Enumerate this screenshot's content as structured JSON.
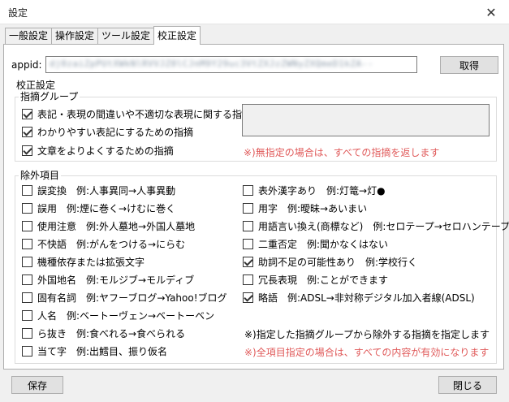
{
  "window": {
    "title": "設定",
    "close_glyph": "✕"
  },
  "tabs": [
    {
      "label": "一般設定",
      "active": false
    },
    {
      "label": "操作設定",
      "active": false
    },
    {
      "label": "ツール設定",
      "active": false
    },
    {
      "label": "校正設定",
      "active": true
    }
  ],
  "appid": {
    "label": "appid:",
    "value": "dj0zaiZpPUtXWkNlRVVJZ0lCJnM9Y29uc3VtZXJzZWNyZXQmeD1kZA--"
  },
  "buttons": {
    "get": "取得",
    "save": "保存",
    "close": "閉じる"
  },
  "section_title": "校正設定",
  "indication_group": {
    "legend": "指摘グループ",
    "items": [
      {
        "label": "表記・表現の間違いや不適切な表現に関する指摘",
        "checked": true
      },
      {
        "label": "わかりやすい表記にするための指摘",
        "checked": true
      },
      {
        "label": "文章をよりよくするための指摘",
        "checked": true
      }
    ],
    "note": "※)無指定の場合は、すべての指摘を返します"
  },
  "exclusion": {
    "legend": "除外項目",
    "left": [
      {
        "label": "誤変換",
        "example": "例:人事異同→人事異動",
        "checked": false
      },
      {
        "label": "誤用",
        "example": "例:煙に巻く→けむに巻く",
        "checked": false
      },
      {
        "label": "使用注意",
        "example": "例:外人墓地→外国人墓地",
        "checked": false
      },
      {
        "label": "不快語",
        "example": "例:がんをつける→にらむ",
        "checked": false
      },
      {
        "label": "機種依存または拡張文字",
        "example": "",
        "checked": false
      },
      {
        "label": "外国地名",
        "example": "例:モルジブ→モルディブ",
        "checked": false
      },
      {
        "label": "固有名詞",
        "example": "例:ヤフーブログ→Yahoo!ブログ",
        "checked": false
      },
      {
        "label": "人名",
        "example": "例:ベートーヴェン→ベートーベン",
        "checked": false
      },
      {
        "label": "ら抜き",
        "example": "例:食べれる→食べられる",
        "checked": false
      },
      {
        "label": "当て字",
        "example": "例:出鱈目、振り仮名",
        "checked": false
      }
    ],
    "right": [
      {
        "label": "表外漢字あり",
        "example": "例:灯篭→灯●",
        "checked": false
      },
      {
        "label": "用字",
        "example": "例:曖昧→あいまい",
        "checked": false
      },
      {
        "label": "用語言い換え(商標など)",
        "example": "例:セロテープ→セロハンテープ",
        "checked": false
      },
      {
        "label": "二重否定",
        "example": "例:聞かなくはない",
        "checked": false
      },
      {
        "label": "助詞不足の可能性あり",
        "example": "例:学校行く",
        "checked": true
      },
      {
        "label": "冗長表現",
        "example": "例:ことができます",
        "checked": false
      },
      {
        "label": "略語",
        "example": "例:ADSL→非対称デジタル加入者線(ADSL)",
        "checked": true
      }
    ],
    "note_black": "※)指定した指摘グループから除外する指摘を指定します",
    "note_red": "※)全項目指定の場合は、すべての内容が有効になります"
  }
}
